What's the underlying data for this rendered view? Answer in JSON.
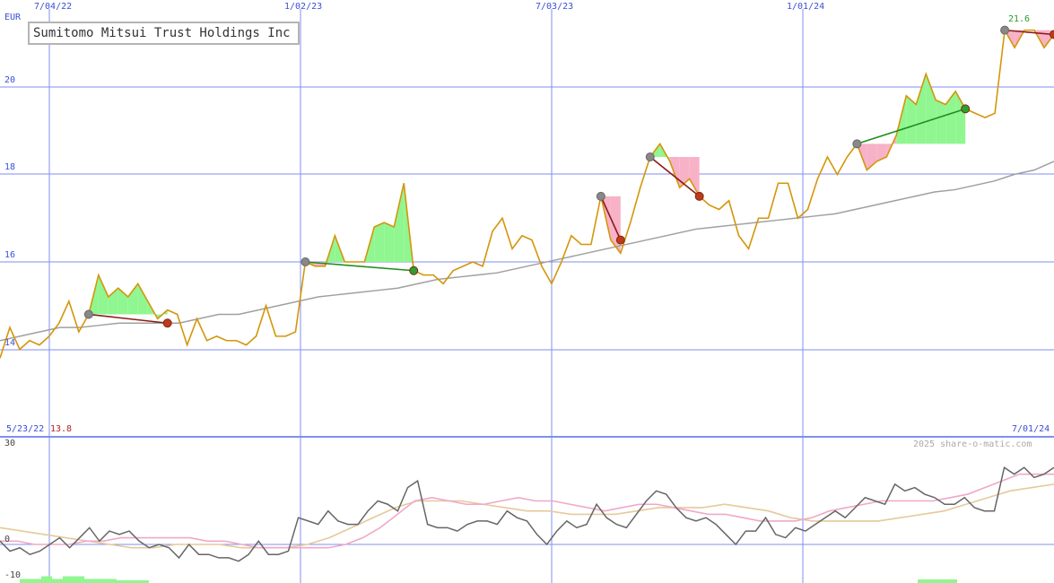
{
  "title": "Sumitomo Mitsui Trust Holdings Inc",
  "currency": "EUR",
  "copyright": "2025 share-o-matic.com",
  "range_start_label": "5/23/22",
  "range_end_label": "7/01/24",
  "min_price_label": "13.8",
  "last_price_label": "21.6",
  "colors": {
    "price": "#d4960a",
    "moving_average": "#a0a0a0",
    "grid": "#7f8ff0",
    "gain_fill": "#90f690",
    "loss_fill": "#f7b2c8",
    "loss_trade_line": "#8b1a1a",
    "gain_trade_line": "#1f8f1f",
    "oscillator": "#666666",
    "osc_fast": "#f0a8c8",
    "osc_slow": "#e6c99a",
    "volume": "#90f690"
  },
  "chart_data": [
    {
      "type": "line",
      "title": "Sumitomo Mitsui Trust Holdings Inc",
      "ylabel": "EUR",
      "ylim": [
        13.8,
        21.6
      ],
      "y_ticks": [
        "14",
        "16",
        "18",
        "20"
      ],
      "x_ticks": [
        "7/04/22",
        "1/02/23",
        "7/03/23",
        "1/01/24"
      ],
      "x_range": [
        "5/23/22",
        "7/01/24"
      ],
      "grid": true,
      "series": [
        {
          "role": "price",
          "values": [
            13.8,
            14.5,
            14.0,
            14.2,
            14.1,
            14.3,
            14.6,
            15.1,
            14.4,
            14.8,
            15.7,
            15.2,
            15.4,
            15.2,
            15.5,
            15.1,
            14.7,
            14.9,
            14.8,
            14.1,
            14.7,
            14.2,
            14.3,
            14.2,
            14.2,
            14.1,
            14.3,
            15.0,
            14.3,
            14.3,
            14.4,
            16.0,
            15.9,
            15.9,
            16.6,
            16.0,
            16.0,
            16.0,
            16.8,
            16.9,
            16.8,
            17.8,
            15.8,
            15.7,
            15.7,
            15.5,
            15.8,
            15.9,
            16.0,
            15.9,
            16.7,
            17.0,
            16.3,
            16.6,
            16.5,
            15.9,
            15.5,
            16.0,
            16.6,
            16.4,
            16.4,
            17.5,
            16.5,
            16.2,
            16.9,
            17.7,
            18.4,
            18.7,
            18.3,
            17.7,
            17.9,
            17.5,
            17.3,
            17.2,
            17.4,
            16.6,
            16.3,
            17.0,
            17.0,
            17.8,
            17.8,
            17.0,
            17.2,
            17.9,
            18.4,
            18.0,
            18.4,
            18.7,
            18.1,
            18.3,
            18.4,
            18.9,
            19.8,
            19.6,
            20.3,
            19.7,
            19.6,
            19.9,
            19.5,
            19.4,
            19.3,
            19.4,
            21.3,
            20.9,
            21.3,
            21.3,
            20.9,
            21.2
          ]
        },
        {
          "role": "moving_average",
          "values": [
            14.2,
            14.3,
            14.4,
            14.5,
            14.5,
            14.55,
            14.6,
            14.6,
            14.6,
            14.6,
            14.7,
            14.8,
            14.8,
            14.9,
            15.0,
            15.1,
            15.2,
            15.25,
            15.3,
            15.35,
            15.4,
            15.5,
            15.6,
            15.65,
            15.7,
            15.75,
            15.85,
            15.95,
            16.05,
            16.15,
            16.25,
            16.35,
            16.45,
            16.55,
            16.65,
            16.75,
            16.8,
            16.85,
            16.9,
            16.95,
            17.0,
            17.05,
            17.1,
            17.2,
            17.3,
            17.4,
            17.5,
            17.6,
            17.65,
            17.75,
            17.85,
            18.0,
            18.1,
            18.3
          ]
        }
      ],
      "trades": [
        {
          "kind": "loss",
          "entry_index": 9,
          "exit_index": 17,
          "entry": 14.8,
          "exit": 14.6
        },
        {
          "kind": "gain",
          "entry_index": 31,
          "exit_index": 42,
          "entry": 16.0,
          "exit": 15.8
        },
        {
          "kind": "loss",
          "entry_index": 61,
          "exit_index": 63,
          "entry": 17.5,
          "exit": 16.5
        },
        {
          "kind": "loss",
          "entry_index": 66,
          "exit_index": 71,
          "entry": 18.4,
          "exit": 17.5
        },
        {
          "kind": "gain",
          "entry_index": 87,
          "exit_index": 98,
          "entry": 18.7,
          "exit": 19.5
        },
        {
          "kind": "loss",
          "entry_index": 102,
          "exit_index": 107,
          "entry": 21.3,
          "exit": 21.2
        }
      ]
    },
    {
      "type": "line",
      "ylim": [
        -10,
        30
      ],
      "y_ticks": [
        "30",
        "0",
        "-10"
      ],
      "grid": true,
      "series": [
        {
          "role": "oscillator",
          "values": [
            1,
            -2,
            -1,
            -3,
            -2,
            0,
            2,
            -1,
            2,
            5,
            1,
            4,
            3,
            4,
            1,
            -1,
            0,
            -1,
            -4,
            0,
            -3,
            -3,
            -4,
            -4,
            -5,
            -3,
            1,
            -3,
            -3,
            -2,
            8,
            7,
            6,
            10,
            7,
            6,
            6,
            10,
            13,
            12,
            10,
            17,
            19,
            6,
            5,
            5,
            4,
            6,
            7,
            7,
            6,
            10,
            8,
            7,
            3,
            0,
            4,
            7,
            5,
            6,
            12,
            8,
            6,
            5,
            9,
            13,
            16,
            15,
            11,
            8,
            7,
            8,
            6,
            3,
            0,
            4,
            4,
            8,
            3,
            2,
            5,
            4,
            6,
            8,
            10,
            8,
            11,
            14,
            13,
            12,
            18,
            16,
            17,
            15,
            14,
            12,
            12,
            14,
            11,
            10,
            10,
            23,
            21,
            23,
            20,
            21,
            23
          ]
        },
        {
          "role": "fast_signal",
          "values": [
            1,
            1,
            0,
            0,
            0,
            1,
            1,
            2,
            2,
            2,
            2,
            2,
            1,
            1,
            0,
            -1,
            -1,
            -1,
            -1,
            -1,
            0,
            2,
            5,
            9,
            13,
            14,
            13,
            12,
            12,
            13,
            14,
            13,
            13,
            12,
            11,
            10,
            11,
            12,
            12,
            11,
            10,
            9,
            9,
            8,
            7,
            7,
            7,
            8,
            10,
            11,
            12,
            13,
            13,
            13,
            13,
            14,
            15,
            17,
            19,
            21,
            21,
            21
          ]
        },
        {
          "role": "slow_signal",
          "values": [
            5,
            4,
            3,
            2,
            1,
            0,
            -1,
            -1,
            0,
            0,
            0,
            -1,
            -1,
            -1,
            0,
            2,
            5,
            8,
            11,
            13,
            13,
            13,
            12,
            11,
            10,
            10,
            9,
            9,
            9,
            10,
            11,
            11,
            11,
            12,
            11,
            10,
            8,
            7,
            7,
            7,
            7,
            8,
            9,
            10,
            12,
            14,
            16,
            17,
            18
          ]
        }
      ],
      "volume_bars": [
        1.5,
        1.5,
        2.5,
        1.5,
        2.5,
        2.5,
        1.5,
        1.5,
        1.5,
        1.0,
        1.0,
        1.0
      ]
    }
  ]
}
